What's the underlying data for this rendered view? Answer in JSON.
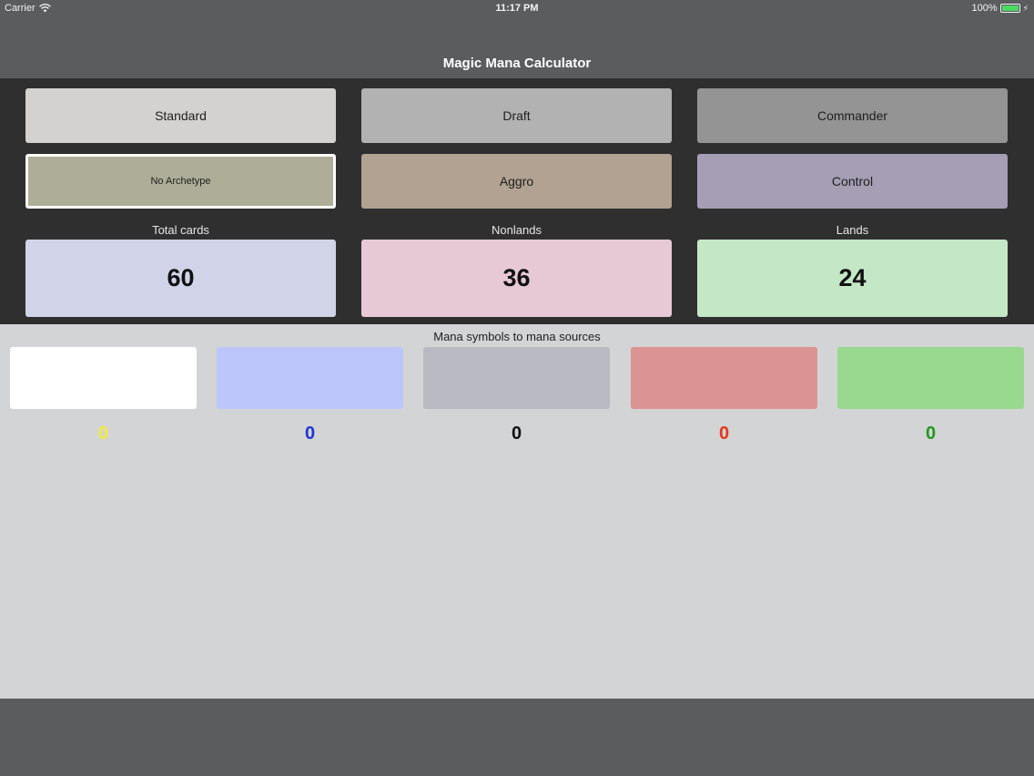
{
  "status": {
    "carrier": "Carrier",
    "time": "11:17 PM",
    "battery": "100%"
  },
  "nav": {
    "title": "Magic Mana Calculator"
  },
  "formats": [
    {
      "label": "Standard",
      "color": "#d3d2d1"
    },
    {
      "label": "Draft",
      "color": "#b3b2b2"
    },
    {
      "label": "Commander",
      "color": "#959494"
    }
  ],
  "archetypes": [
    {
      "label": "No Archetype",
      "color": "#aeae98",
      "selected": true
    },
    {
      "label": "Aggro",
      "color": "#b2a291"
    },
    {
      "label": "Control",
      "color": "#a59eb4"
    }
  ],
  "stats": [
    {
      "label": "Total cards",
      "value": "60",
      "color": "#d1d4e8"
    },
    {
      "label": "Nonlands",
      "value": "36",
      "color": "#e7c9d5"
    },
    {
      "label": "Lands",
      "value": "24",
      "color": "#c4e7c5"
    }
  ],
  "mana": {
    "title": "Mana symbols to mana sources",
    "sources": [
      {
        "color_name": "white",
        "box_color": "#ffffff",
        "count": "0",
        "count_color": "#f5e83a"
      },
      {
        "color_name": "blue",
        "box_color": "#bcc6fb",
        "count": "0",
        "count_color": "#1f35d1"
      },
      {
        "color_name": "black",
        "box_color": "#b9b9c1",
        "count": "0",
        "count_color": "#111111"
      },
      {
        "color_name": "red",
        "box_color": "#dc9393",
        "count": "0",
        "count_color": "#e8351c"
      },
      {
        "color_name": "green",
        "box_color": "#98d88f",
        "count": "0",
        "count_color": "#1f9a1f"
      }
    ]
  }
}
